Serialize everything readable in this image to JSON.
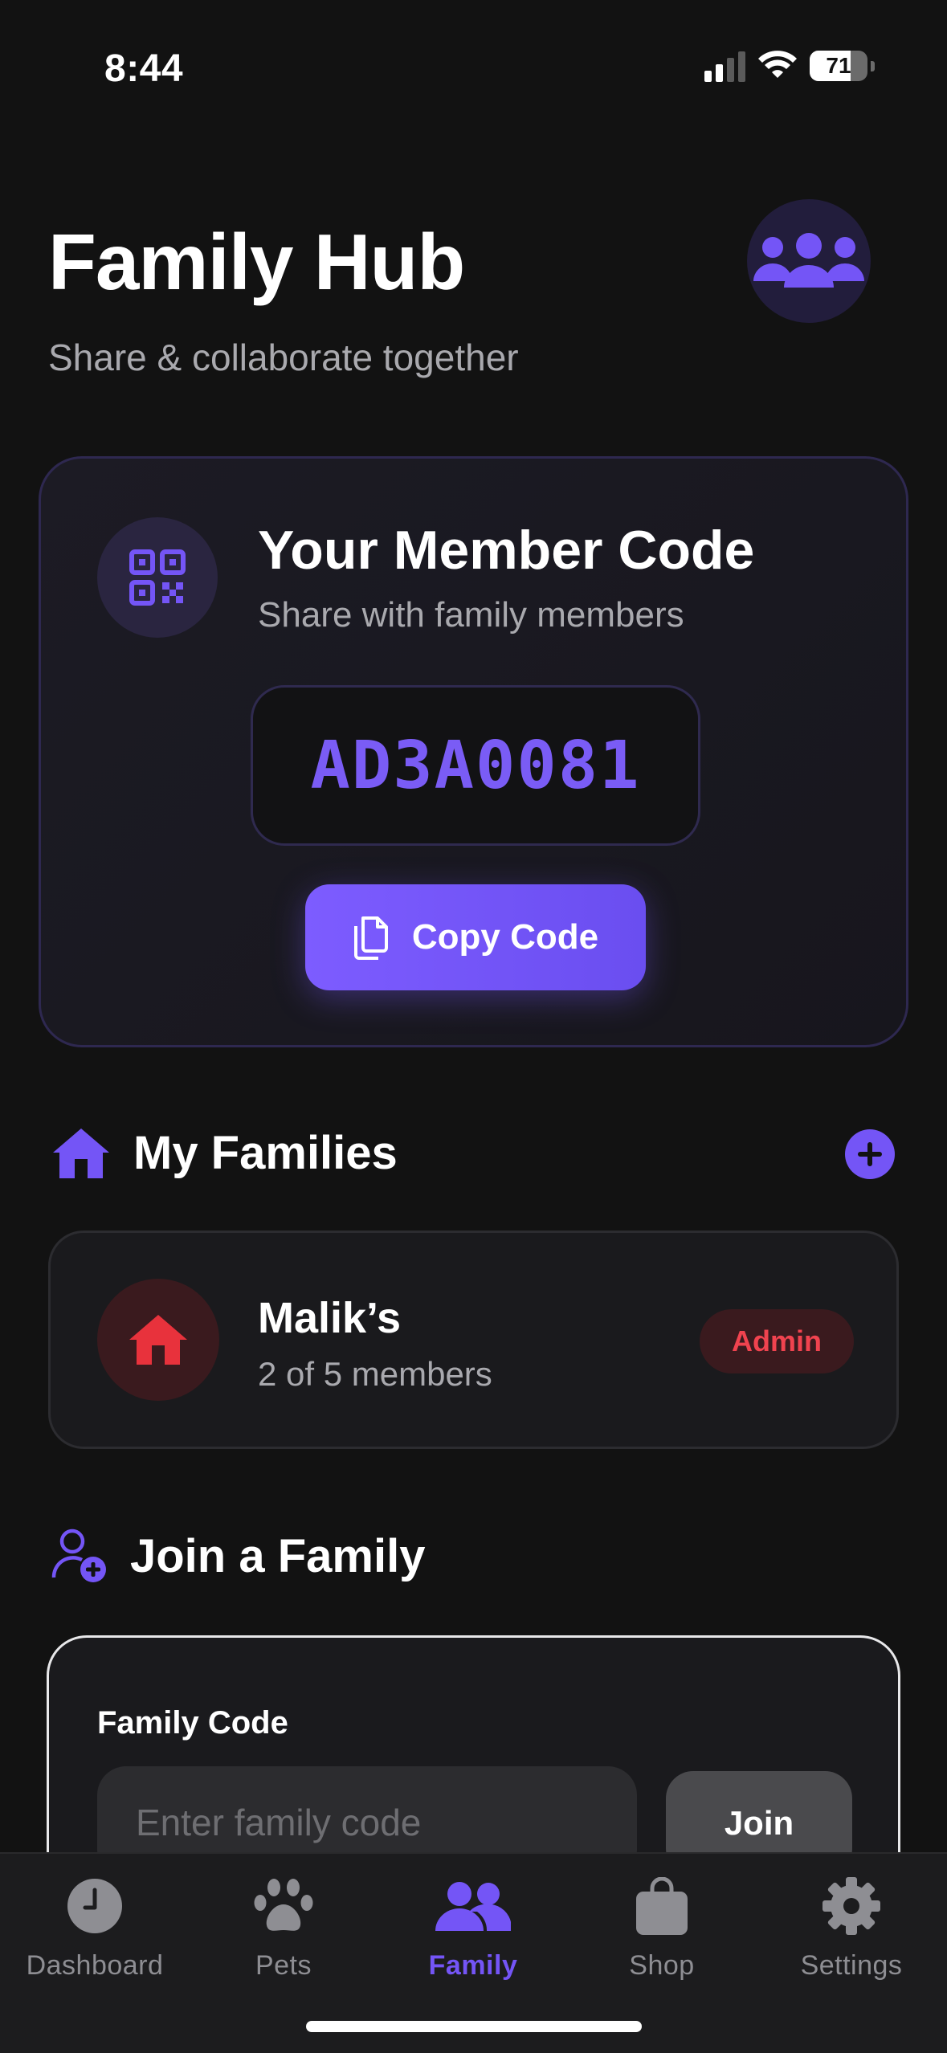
{
  "status_bar": {
    "time": "8:44",
    "battery": "71"
  },
  "header": {
    "title": "Family Hub",
    "subtitle": "Share & collaborate together"
  },
  "member_code": {
    "title": "Your Member Code",
    "subtitle": "Share with family members",
    "code": "AD3A0081",
    "copy_label": "Copy Code"
  },
  "my_families": {
    "title": "My Families",
    "items": [
      {
        "name": "Malik’s",
        "members": "2 of 5 members",
        "role": "Admin"
      }
    ]
  },
  "join_family": {
    "title": "Join a Family",
    "field_label": "Family Code",
    "placeholder": "Enter family code",
    "join_label": "Join"
  },
  "tabs": [
    {
      "label": "Dashboard",
      "icon": "clock-icon",
      "active": false
    },
    {
      "label": "Pets",
      "icon": "paw-icon",
      "active": false
    },
    {
      "label": "Family",
      "icon": "users-icon",
      "active": true
    },
    {
      "label": "Shop",
      "icon": "shopping-bag-icon",
      "active": false
    },
    {
      "label": "Settings",
      "icon": "gear-icon",
      "active": false
    }
  ],
  "colors": {
    "accent": "#7455f6",
    "background": "#121212",
    "admin_red": "#f0434f",
    "home_red": "#e8323c"
  }
}
